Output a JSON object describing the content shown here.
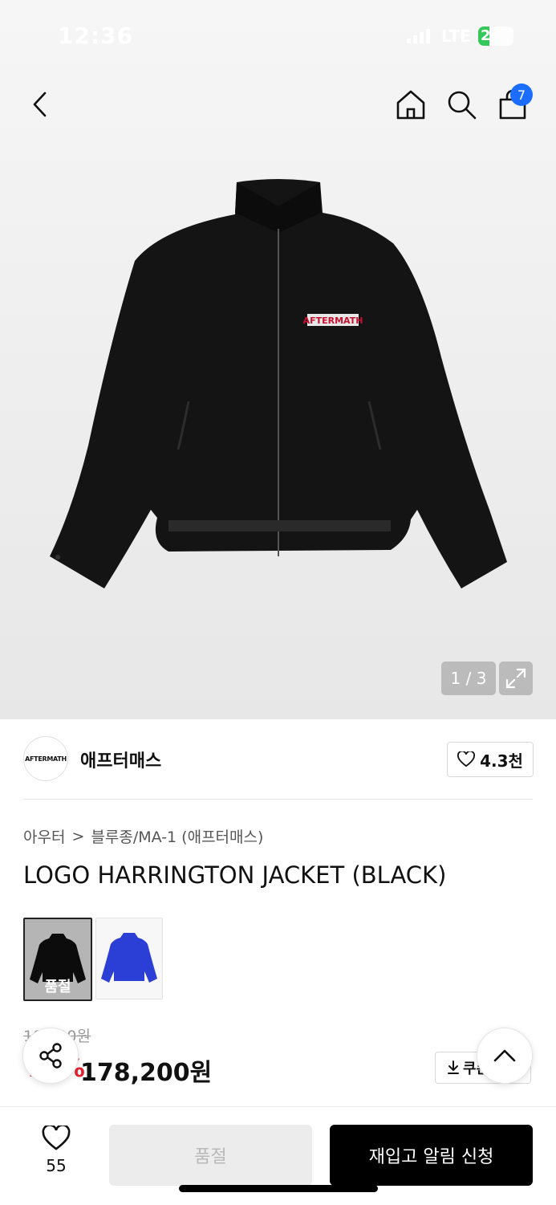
{
  "status_bar": {
    "time": "12:36",
    "network": "LTE",
    "battery": "24"
  },
  "header": {
    "cart_count": "7"
  },
  "gallery": {
    "counter": "1 / 3",
    "patch_text": "AFTERMATH"
  },
  "brand": {
    "logo_text": "AFTERMATH",
    "name": "애프터매스",
    "likes": "4.3천"
  },
  "breadcrumb": {
    "category": "아우터",
    "separator": ">",
    "subcategory": "블루종/MA-1 (애프터매스)"
  },
  "product": {
    "title": "LOGO HARRINGTON JACKET (BLACK)"
  },
  "options": [
    {
      "color": "#111111",
      "sold_out_label": "품절",
      "selected": true
    },
    {
      "color": "#2b3fd6",
      "selected": false
    }
  ],
  "pricing": {
    "original_price": "198,000원",
    "original_price_visible": "19‧‧‧00원",
    "discount_rate": "10%",
    "sale_price": "178,200원",
    "coupon_label": "쿠폰"
  },
  "bottom": {
    "wish_count": "55",
    "soldout_label": "품절",
    "restock_label": "재입고 알림 신청"
  },
  "colors": {
    "accent": "#1a6dff",
    "discount": "#e81f2d",
    "primary_button": "#000000"
  }
}
